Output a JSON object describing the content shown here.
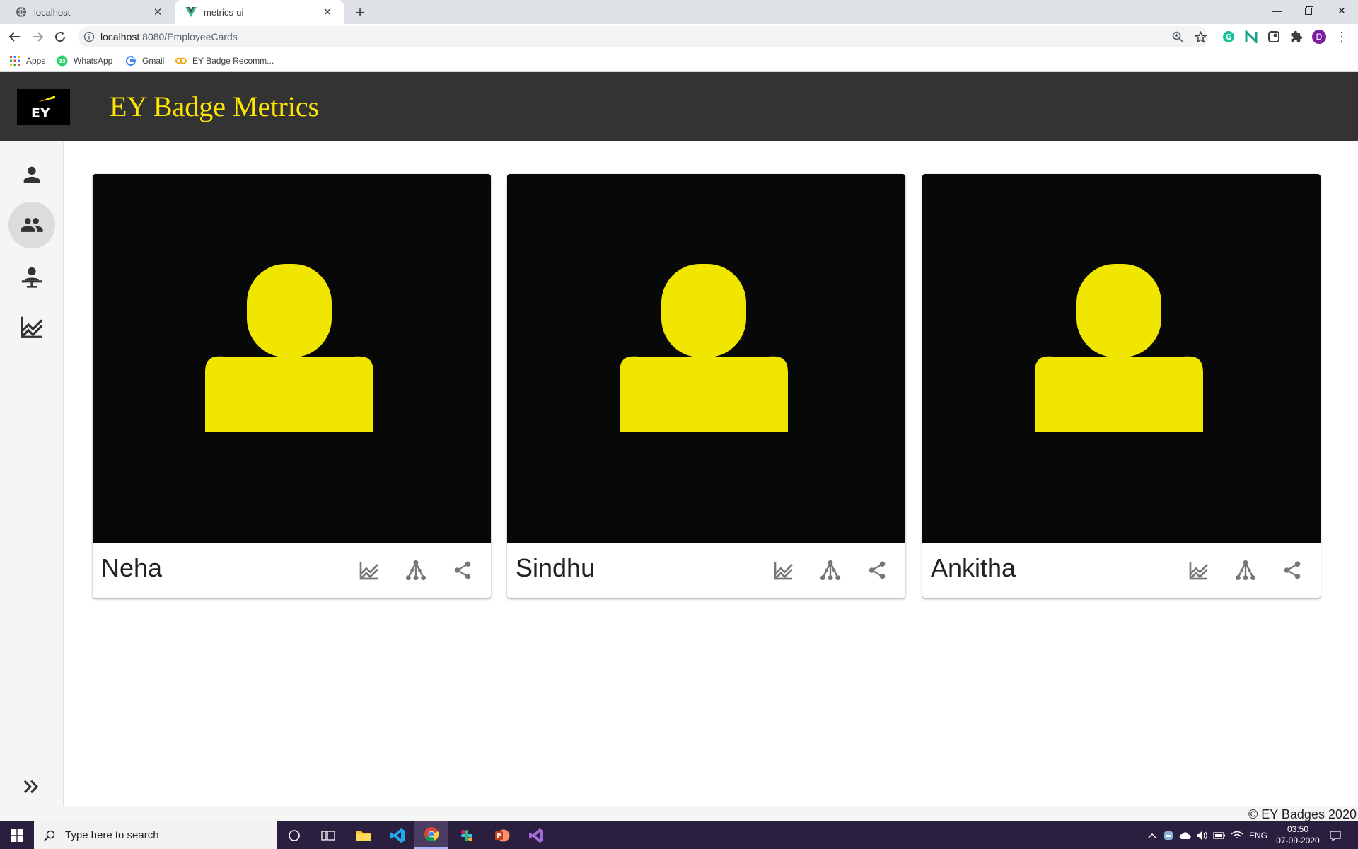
{
  "browser": {
    "tabs": [
      {
        "title": "localhost",
        "active": false
      },
      {
        "title": "metrics-ui",
        "active": true
      }
    ],
    "url_host": "localhost",
    "url_path": ":8080/EmployeeCards",
    "bookmarks": [
      {
        "label": "Apps",
        "icon": "apps-grid-icon"
      },
      {
        "label": "WhatsApp",
        "icon": "whatsapp-icon",
        "badge": "33"
      },
      {
        "label": "Gmail",
        "icon": "google-icon"
      },
      {
        "label": "EY Badge Recomm...",
        "icon": "link-icon"
      }
    ],
    "profile_initial": "D"
  },
  "app": {
    "title": "EY Badge Metrics",
    "logo_text": "EY",
    "accent_color": "#ffe600",
    "header_color": "#333333",
    "sidebar": [
      {
        "icon": "person-icon",
        "active": false
      },
      {
        "icon": "people-icon",
        "active": true
      },
      {
        "icon": "presenter-icon",
        "active": false
      },
      {
        "icon": "chart-icon",
        "active": false
      }
    ],
    "employees": [
      {
        "name": "Neha"
      },
      {
        "name": "Sindhu"
      },
      {
        "name": "Ankitha"
      }
    ],
    "footer": "© EY Badges 2020"
  },
  "taskbar": {
    "search_placeholder": "Type here to search",
    "language": "ENG",
    "time": "03:50",
    "date": "07-09-2020"
  }
}
